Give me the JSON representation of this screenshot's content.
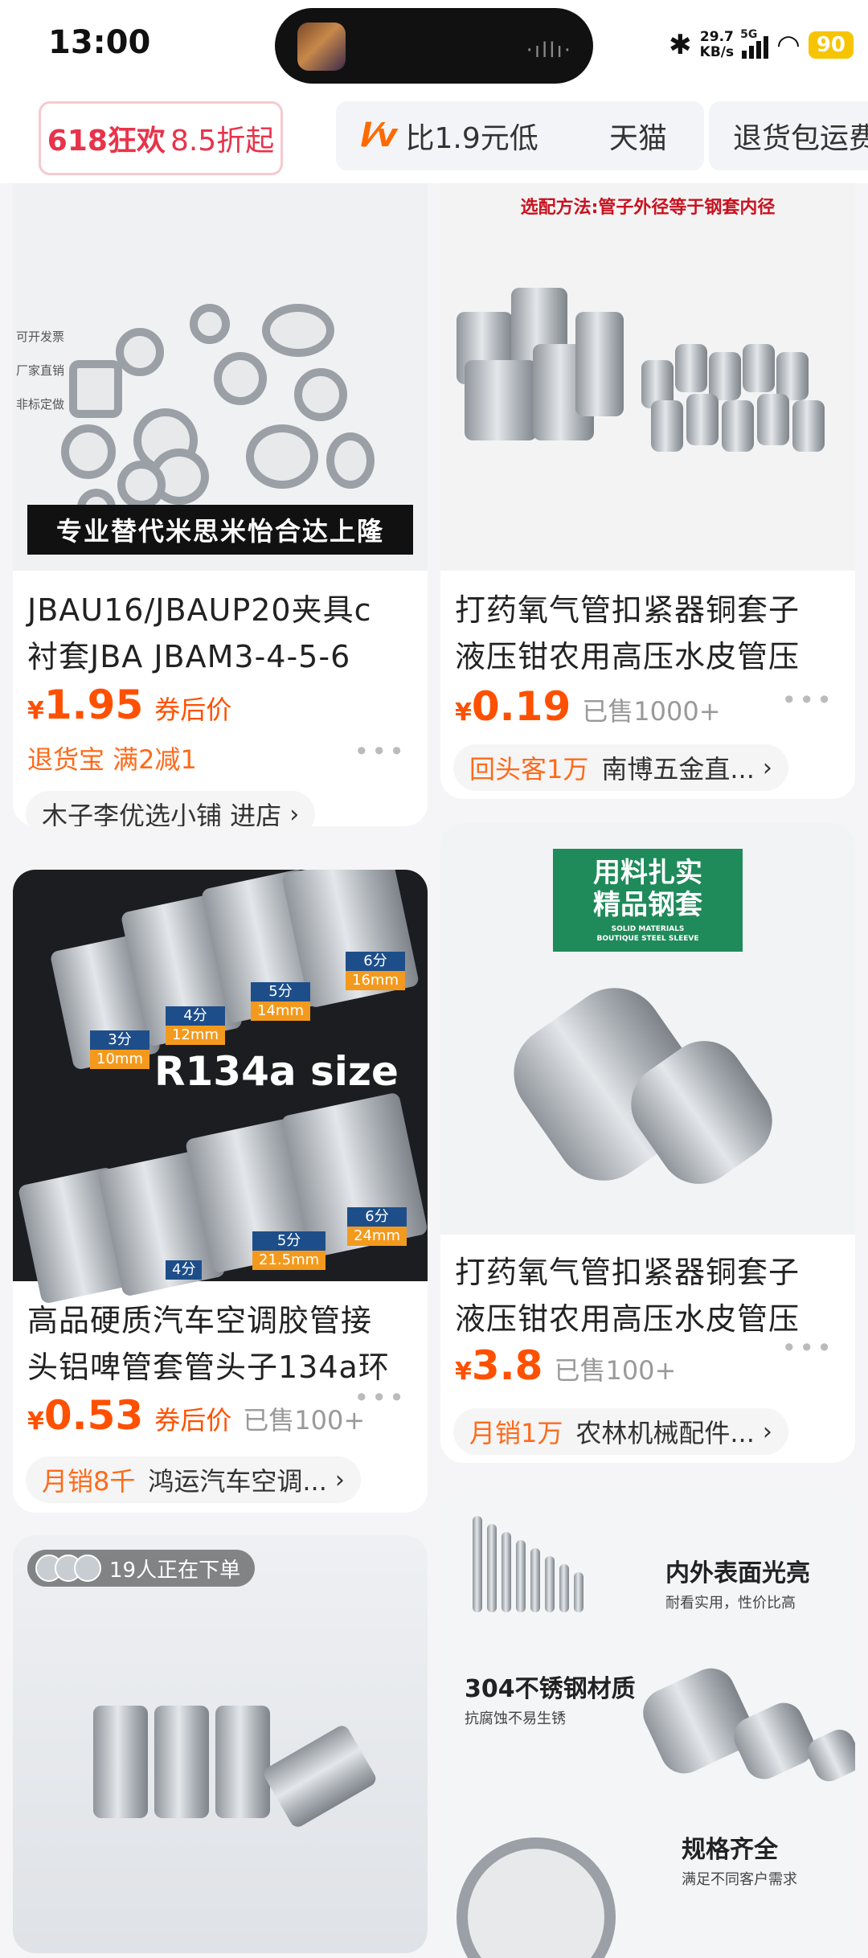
{
  "status_bar": {
    "time": "13:00",
    "net_speed_value": "29.7",
    "net_speed_unit": "KB/s",
    "network": "5G",
    "battery": "90"
  },
  "filters": [
    {
      "label_main": "618狂欢",
      "label_sub": "8.5折起"
    },
    {
      "logo": "lv",
      "label": "比1.9元低"
    },
    {
      "label": "天猫"
    },
    {
      "label": "退货包运费"
    }
  ],
  "products": [
    {
      "image_banner": "专业替代米思米怡合达上隆",
      "image_side_notes": [
        "可开发票",
        "厂家直销",
        "非标定做"
      ],
      "title_line1": "JBAU16/JBAUP20夹具c",
      "title_line2": "衬套JBA JBAM3-4-5-6",
      "currency": "¥",
      "price": "1.95",
      "price_tag": "券后价",
      "promo": "退货宝  满2减1",
      "shop": "木子李优选小铺 进店"
    },
    {
      "image_header": "选配方法:管子外径等于钢套内径",
      "title_line1": "打药氧气管扣紧器铜套子",
      "title_line2": "液压钳农用高压水皮管压",
      "currency": "¥",
      "price": "0.19",
      "sold": "已售1000+",
      "shop_highlight": "回头客1万",
      "shop": "南博五金直..."
    },
    {
      "image_caption": "R134a size",
      "image_sizes_top": [
        {
          "t": "3分",
          "b": "10mm"
        },
        {
          "t": "4分",
          "b": "12mm"
        },
        {
          "t": "5分",
          "b": "14mm"
        },
        {
          "t": "6分",
          "b": "16mm"
        }
      ],
      "image_sizes_bottom": [
        {
          "t": "4分",
          "b": ""
        },
        {
          "t": "5分",
          "b": "21.5mm"
        },
        {
          "t": "6分",
          "b": "24mm"
        }
      ],
      "title_line1": "高品硬质汽车空调胶管接",
      "title_line2": "头铝啤管套管头子134a环",
      "currency": "¥",
      "price": "0.53",
      "price_tag": "券后价",
      "sold": "已售100+",
      "shop_highlight": "月销8千",
      "shop": "鸿运汽车空调..."
    },
    {
      "image_box_line1": "用料扎实",
      "image_box_line2": "精品钢套",
      "image_box_en1": "SOLID MATERIALS",
      "image_box_en2": "BOUTIQUE STEEL SLEEVE",
      "title_line1": "打药氧气管扣紧器铜套子",
      "title_line2": "液压钳农用高压水皮管压",
      "currency": "¥",
      "price": "3.8",
      "sold": "已售100+",
      "shop_highlight": "月销1万",
      "shop": "农林机械配件..."
    },
    {
      "image_badge": "19人正在下单"
    },
    {
      "feature1": "内外表面光亮",
      "feature1_sub": "耐看实用，性价比高",
      "feature2": "304不锈钢材质",
      "feature2_sub": "抗腐蚀不易生锈",
      "feature3": "规格齐全",
      "feature3_sub": "满足不同客户需求"
    }
  ],
  "colors": {
    "price": "#ff5000",
    "accent": "#ff6a1a",
    "promo_red": "#e8334a",
    "battery": "#f6c400"
  }
}
